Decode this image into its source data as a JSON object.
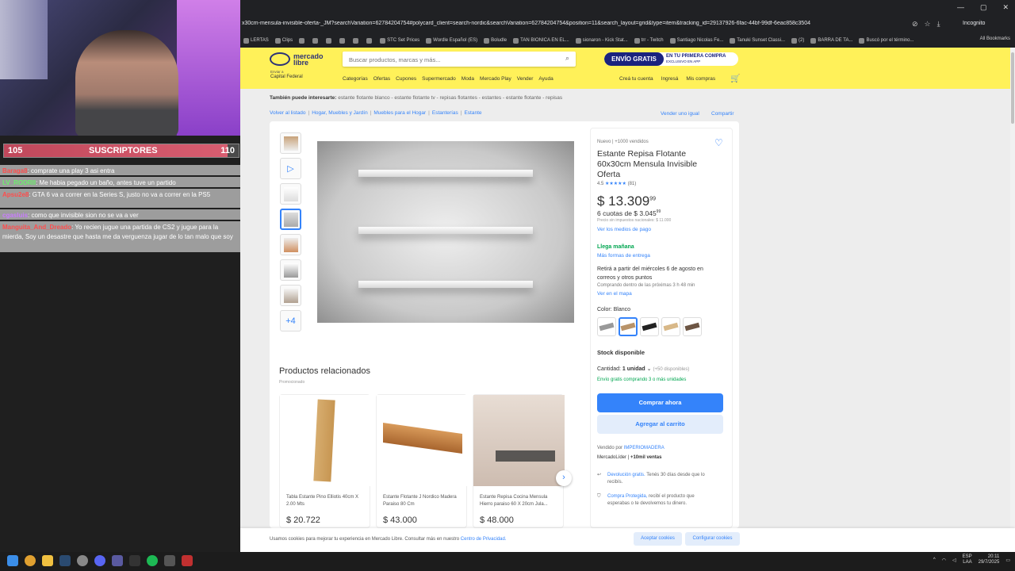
{
  "overlay": {
    "sub_bar": {
      "current": "105",
      "label": "SUSCRIPTORES",
      "goal": "110",
      "progress": 0.954
    },
    "chat": [
      {
        "user": "Baraga8",
        "message": ": comprate una play 3 asi entra"
      },
      {
        "user": "LV_RODRII",
        "message": ": Me habia pegado un baño, antes tuve un partido"
      },
      {
        "user": "Apsu2e8",
        "message": ": GTA 6 va a correr en la Series S, justo no va a correr en la PS5"
      },
      {
        "user": "cgasluis",
        "message": ": como que invisible sion no se va a ver"
      },
      {
        "user": "Manguita_And_Dreado",
        "message": ": Yo recien jugue una partida de CS2 y jugue para la mierda, Soy un desastre que hasta me da verguenza jugar de lo tan malo que soy"
      }
    ]
  },
  "browser": {
    "url": "x30cm-mensula-invisible-oferta-_JM?searchVariation=62784204754#polycard_client=search-nordic&searchVariation=62784204754&position=11&search_layout=grid&type=item&tracking_id=29137926-6fac-44bf-99df-6eac858c3504",
    "incognito_label": "Incognito",
    "all_bookmarks": "All Bookmarks",
    "bookmarks": [
      "LERTAS",
      "Clips",
      "",
      "",
      "",
      "",
      "",
      "",
      "STC Set Prices",
      "Wordle Español (ES)",
      "Boludle",
      "TAN BIONICA EN EL...",
      "sionaron - Kick Stat...",
      "trr - Twitch",
      "Santiago Nicolas Fe...",
      "Tanuki Sunset Classi...",
      "(2)",
      "BARRA DE TA...",
      "Buscó por el término..."
    ]
  },
  "header": {
    "logo_text": "mercado libre",
    "search_placeholder": "Buscar productos, marcas y más...",
    "promo_left": "ENVÍO GRATIS",
    "promo_right": "EN TU PRIMERA COMPRA",
    "promo_small": "EXCLUSIVO EN APP",
    "location_label": "Enviar a",
    "location": "Capital Federal",
    "nav": [
      "Categorías",
      "Ofertas",
      "Cupones",
      "Supermercado",
      "Moda",
      "Mercado Play",
      "Vender",
      "Ayuda"
    ],
    "user_nav": [
      "Creá tu cuenta",
      "Ingresá",
      "Mis compras"
    ]
  },
  "suggest": {
    "label": "También puede interesarte:",
    "items": "estante flotante blanco - estante flotante tv - repisas flotantes - estantes - estante flotante - repisas"
  },
  "breadcrumb": [
    "Volver al listado",
    "Hogar, Muebles y Jardín",
    "Muebles para el Hogar",
    "Estanterías",
    "Estante"
  ],
  "sell_link": "Vender uno igual",
  "share_link": "Compartir",
  "thumbnails_more": "+4",
  "product": {
    "condition": "Nuevo  |  +1000 vendidos",
    "title_1": "Estante Repisa Flotante",
    "title_2": "60x30cm Mensula Invisible",
    "title_3": "Oferta",
    "rating": "4.5",
    "stars": "★★★★★",
    "reviews": "(81)",
    "price": "$ 13.309",
    "price_cents": "99",
    "installments": "6 cuotas de $ 3.045",
    "installments_cents": "99",
    "no_tax": "Precio sin impuestos nacionales: $ 11.000",
    "payment_link": "Ver los medios de pago",
    "arrival": "Llega mañana",
    "more_shipping": "Más formas de entrega",
    "pickup": "Retirá a partir del miércoles 6 de agosto en",
    "pickup_2": "correos y otros puntos",
    "pickup_time": "Comprando dentro de las próximas 3 h 48 min",
    "map_link": "Ver en el mapa",
    "color_label": "Color:",
    "color_value": "Blanco",
    "stock": "Stock disponible",
    "qty_label": "Cantidad:",
    "qty_value": "1 unidad",
    "qty_avail": "(+50 disponibles)",
    "free_ship": "Envío gratis comprando 3 o más unidades",
    "buy_now": "Comprar ahora",
    "add_cart": "Agregar al carrito",
    "seller_label": "Vendido por",
    "seller": "IMPERIOMADERA",
    "leader": "MercadoLíder",
    "sales": "+10mil ventas",
    "returns_link": "Devolución gratis.",
    "returns_text": "Tenés 30 días desde que lo",
    "returns_text2": "recibís.",
    "protect_link": "Compra Protegida,",
    "protect_text": "recibí el producto que",
    "protect_text2": "esperabas o te devolvemos tu dinero."
  },
  "related": {
    "title": "Productos relacionados",
    "sub": "Promocionado",
    "items": [
      {
        "name": "Tabla Estante Pino Elliotis 40cm X 2.00 Mts",
        "price": "$ 20.722"
      },
      {
        "name": "Estante Flotante J Nordico Madera Paraiso 80 Cm",
        "price": "$ 43.000"
      },
      {
        "name": "Estante Repisa Cocina Mensula Hierro paraiso 60 X 20cm Jula...",
        "price": "$ 48.000"
      }
    ]
  },
  "cookie": {
    "text": "Usamos cookies para mejorar tu experiencia en Mercado Libre. Consultar más en nuestro",
    "link": "Centro de Privacidad.",
    "accept": "Aceptar cookies",
    "config": "Configurar cookies"
  },
  "taskbar": {
    "lang": "ESP",
    "lang2": "LAA",
    "time": "20:11",
    "date": "29/7/2025"
  }
}
